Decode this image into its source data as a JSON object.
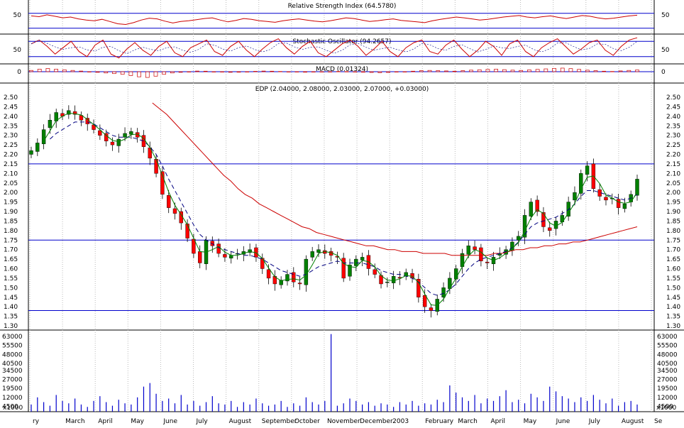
{
  "chart_data": [
    {
      "panel": "rsi",
      "type": "line",
      "title": "Relative Strength Index (64.5780)",
      "y_ticks": [
        "50"
      ],
      "reference_levels": [
        70,
        30
      ],
      "line_color": "#cc0000",
      "level_color": "#0000cc",
      "series": [
        {
          "values": [
            63,
            61,
            66,
            62,
            58,
            60,
            55,
            52,
            50,
            54,
            48,
            42,
            40,
            45,
            52,
            57,
            55,
            49,
            44,
            48,
            50,
            53,
            56,
            58,
            52,
            47,
            51,
            56,
            54,
            50,
            48,
            46,
            50,
            53,
            55,
            52,
            49,
            47,
            50,
            54,
            58,
            56,
            52,
            48,
            50,
            53,
            55,
            51,
            49,
            47,
            45,
            50,
            54,
            57,
            60,
            58,
            55,
            52,
            54,
            57,
            60,
            62,
            64,
            60,
            58,
            61,
            63,
            59,
            56,
            60,
            64,
            62,
            58,
            55,
            57,
            60,
            63,
            65
          ]
        }
      ]
    },
    {
      "panel": "stochastic",
      "type": "line",
      "title": "Stochastic Oscillator (94.2657)",
      "y_ticks": [
        "50"
      ],
      "reference_levels": [
        80,
        20
      ],
      "line_color": "#cc0000",
      "level_color": "#0000cc",
      "series": [
        {
          "values": [
            70,
            85,
            60,
            30,
            55,
            80,
            40,
            20,
            65,
            85,
            30,
            15,
            50,
            75,
            45,
            25,
            60,
            80,
            35,
            20,
            55,
            70,
            85,
            40,
            25,
            60,
            80,
            45,
            20,
            50,
            75,
            90,
            55,
            30,
            60,
            80,
            35,
            20,
            45,
            70,
            85,
            60,
            25,
            50,
            80,
            40,
            20,
            55,
            75,
            85,
            40,
            30,
            65,
            85,
            50,
            20,
            45,
            80,
            60,
            25,
            70,
            85,
            40,
            20,
            55,
            75,
            90,
            60,
            30,
            50,
            75,
            85,
            45,
            25,
            60,
            85,
            94
          ]
        }
      ]
    },
    {
      "panel": "macd",
      "type": "bar",
      "title": "MACD (0.01324)",
      "y_ticks": [
        "0"
      ],
      "bar_color": "#cc0000",
      "series": [
        {
          "values": [
            0.01,
            0.02,
            0.025,
            0.02,
            0.015,
            0.01,
            0.005,
            0.0,
            -0.005,
            -0.01,
            -0.015,
            -0.02,
            -0.03,
            -0.04,
            -0.045,
            -0.035,
            -0.02,
            -0.01,
            -0.005,
            0.0,
            0.005,
            0.004,
            0.0,
            -0.003,
            -0.005,
            -0.004,
            0.0,
            0.003,
            0.005,
            0.004,
            0.002,
            0.0,
            -0.002,
            -0.004,
            -0.003,
            -0.001,
            0.0,
            0.002,
            0.001,
            -0.002,
            -0.004,
            -0.006,
            -0.008,
            -0.006,
            -0.003,
            0.0,
            0.004,
            0.008,
            0.01,
            0.008,
            0.006,
            0.004,
            0.008,
            0.012,
            0.015,
            0.018,
            0.02,
            0.016,
            0.012,
            0.01,
            0.014,
            0.018,
            0.022,
            0.026,
            0.028,
            0.024,
            0.018,
            0.012,
            0.008,
            0.004,
            0.002,
            0.006,
            0.01,
            0.013
          ]
        }
      ]
    },
    {
      "panel": "price",
      "type": "candlestick",
      "title": "EDP (2.04000, 2.08000, 2.03000, 2.07000, +0.03000)",
      "ylim": [
        1.3,
        2.5
      ],
      "y_ticks": [
        "2.50",
        "2.45",
        "2.40",
        "2.35",
        "2.30",
        "2.25",
        "2.20",
        "2.15",
        "2.10",
        "2.05",
        "2.00",
        "1.95",
        "1.90",
        "1.85",
        "1.80",
        "1.75",
        "1.70",
        "1.65",
        "1.60",
        "1.55",
        "1.50",
        "1.45",
        "1.40",
        "1.35",
        "1.30"
      ],
      "horizontal_lines": [
        2.15,
        1.75,
        1.38
      ],
      "up_color": "#008000",
      "down_color": "#ff0000",
      "ma_short_color": "#008000",
      "ma_mid_color": "#000080",
      "ma_long_color": "#cc0000",
      "close": [
        2.22,
        2.26,
        2.33,
        2.38,
        2.42,
        2.4,
        2.43,
        2.41,
        2.38,
        2.36,
        2.33,
        2.3,
        2.27,
        2.25,
        2.28,
        2.31,
        2.32,
        2.29,
        2.24,
        2.18,
        2.1,
        1.99,
        1.92,
        1.89,
        1.84,
        1.76,
        1.68,
        1.63,
        1.75,
        1.72,
        1.68,
        1.66,
        1.67,
        1.68,
        1.69,
        1.7,
        1.66,
        1.6,
        1.55,
        1.52,
        1.54,
        1.57,
        1.53,
        1.52,
        1.65,
        1.69,
        1.7,
        1.68,
        1.67,
        1.66,
        1.55,
        1.62,
        1.65,
        1.66,
        1.6,
        1.57,
        1.52,
        1.53,
        1.56,
        1.55,
        1.58,
        1.55,
        1.45,
        1.4,
        1.38,
        1.44,
        1.5,
        1.55,
        1.6,
        1.68,
        1.72,
        1.7,
        1.64,
        1.63,
        1.66,
        1.68,
        1.7,
        1.74,
        1.77,
        1.88,
        1.95,
        1.9,
        1.82,
        1.8,
        1.85,
        1.88,
        1.95,
        2.0,
        2.1,
        2.14,
        2.02,
        1.98,
        1.96,
        1.97,
        1.92,
        1.94,
        1.99,
        2.07
      ],
      "ma_mid": [
        null,
        null,
        null,
        2.28,
        2.31,
        2.33,
        2.35,
        2.37,
        2.37,
        2.37,
        2.36,
        2.34,
        2.32,
        2.3,
        2.29,
        2.29,
        2.29,
        2.28,
        2.27,
        2.24,
        2.2,
        2.14,
        2.07,
        2.01,
        1.95,
        1.89,
        1.83,
        1.78,
        1.75,
        1.73,
        1.71,
        1.7,
        1.69,
        1.68,
        1.67,
        1.67,
        1.66,
        1.65,
        1.63,
        1.61,
        1.59,
        1.58,
        1.57,
        1.56,
        1.57,
        1.59,
        1.61,
        1.62,
        1.63,
        1.64,
        1.63,
        1.63,
        1.63,
        1.63,
        1.62,
        1.61,
        1.59,
        1.58,
        1.57,
        1.57,
        1.56,
        1.55,
        1.53,
        1.5,
        1.47,
        1.46,
        1.47,
        1.49,
        1.52,
        1.56,
        1.6,
        1.63,
        1.65,
        1.66,
        1.67,
        1.68,
        1.69,
        1.71,
        1.74,
        1.78,
        1.82,
        1.84,
        1.85,
        1.86,
        1.87,
        1.89,
        1.91,
        1.94,
        1.98,
        2.01,
        2.01,
        2.0,
        1.99,
        1.98,
        1.97,
        1.96,
        1.97,
        1.99
      ],
      "ma_long": [
        null,
        null,
        null,
        null,
        null,
        null,
        null,
        null,
        null,
        null,
        null,
        null,
        null,
        null,
        null,
        null,
        null,
        2.47,
        2.44,
        2.41,
        2.37,
        2.33,
        2.29,
        2.25,
        2.21,
        2.17,
        2.13,
        2.09,
        2.06,
        2.02,
        1.99,
        1.97,
        1.94,
        1.92,
        1.9,
        1.88,
        1.86,
        1.84,
        1.82,
        1.81,
        1.79,
        1.78,
        1.77,
        1.76,
        1.75,
        1.74,
        1.73,
        1.72,
        1.72,
        1.71,
        1.7,
        1.7,
        1.69,
        1.69,
        1.69,
        1.68,
        1.68,
        1.68,
        1.68,
        1.67,
        1.67,
        1.67,
        1.67,
        1.67,
        1.67,
        1.68,
        1.68,
        1.69,
        1.7,
        1.7,
        1.71,
        1.71,
        1.72,
        1.72,
        1.73,
        1.73,
        1.74,
        1.74,
        1.75,
        1.76,
        1.77,
        1.78,
        1.79,
        1.8,
        1.81,
        1.82
      ]
    },
    {
      "panel": "volume",
      "type": "bar",
      "ylabel": "x1000",
      "ylim": [
        0,
        66000
      ],
      "y_ticks": [
        "63000",
        "55500",
        "48000",
        "40500",
        "34500",
        "27000",
        "19500",
        "12000",
        "4500"
      ],
      "bar_color": "#0000cc",
      "values": [
        6000,
        12000,
        8000,
        5000,
        14000,
        9000,
        7000,
        11000,
        6000,
        4000,
        9000,
        13000,
        8000,
        5000,
        10000,
        7000,
        6000,
        12000,
        21000,
        24000,
        15000,
        9000,
        11000,
        7000,
        14000,
        6000,
        9000,
        5000,
        8000,
        13000,
        7000,
        6000,
        9000,
        4000,
        8000,
        6000,
        11000,
        7000,
        5000,
        6000,
        9000,
        4000,
        7000,
        5000,
        12000,
        8000,
        6000,
        9000,
        65000,
        5000,
        7000,
        11000,
        9000,
        6000,
        8000,
        5000,
        7000,
        6000,
        4000,
        8000,
        6000,
        9000,
        5000,
        7000,
        6000,
        10000,
        8000,
        22000,
        16000,
        12000,
        9000,
        14000,
        7000,
        11000,
        9000,
        13000,
        18000,
        8000,
        10000,
        7000,
        15000,
        12000,
        9000,
        21000,
        17000,
        13000,
        11000,
        8000,
        12000,
        9000,
        14000,
        10000,
        7000,
        11000,
        5000,
        8000,
        9000,
        6000
      ],
      "x_tick_labels": [
        "ry",
        "March",
        "April",
        "May",
        "June",
        "July",
        "August",
        "September",
        "October",
        "November",
        "December",
        "2003",
        "February",
        "March",
        "April",
        "May",
        "June",
        "July",
        "August",
        "Se"
      ]
    }
  ]
}
